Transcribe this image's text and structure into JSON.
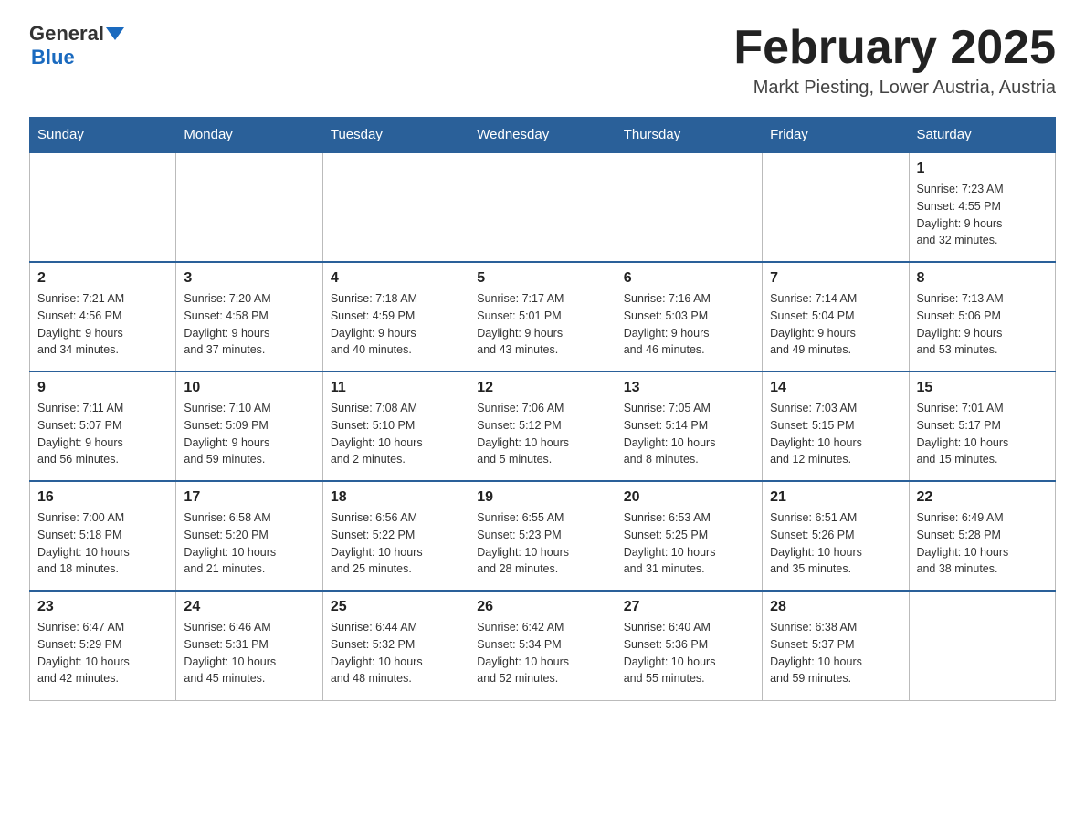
{
  "header": {
    "logo_line1": "General",
    "logo_line2": "Blue",
    "month_title": "February 2025",
    "location": "Markt Piesting, Lower Austria, Austria"
  },
  "calendar": {
    "days_of_week": [
      "Sunday",
      "Monday",
      "Tuesday",
      "Wednesday",
      "Thursday",
      "Friday",
      "Saturday"
    ],
    "weeks": [
      [
        {
          "day": "",
          "info": ""
        },
        {
          "day": "",
          "info": ""
        },
        {
          "day": "",
          "info": ""
        },
        {
          "day": "",
          "info": ""
        },
        {
          "day": "",
          "info": ""
        },
        {
          "day": "",
          "info": ""
        },
        {
          "day": "1",
          "info": "Sunrise: 7:23 AM\nSunset: 4:55 PM\nDaylight: 9 hours\nand 32 minutes."
        }
      ],
      [
        {
          "day": "2",
          "info": "Sunrise: 7:21 AM\nSunset: 4:56 PM\nDaylight: 9 hours\nand 34 minutes."
        },
        {
          "day": "3",
          "info": "Sunrise: 7:20 AM\nSunset: 4:58 PM\nDaylight: 9 hours\nand 37 minutes."
        },
        {
          "day": "4",
          "info": "Sunrise: 7:18 AM\nSunset: 4:59 PM\nDaylight: 9 hours\nand 40 minutes."
        },
        {
          "day": "5",
          "info": "Sunrise: 7:17 AM\nSunset: 5:01 PM\nDaylight: 9 hours\nand 43 minutes."
        },
        {
          "day": "6",
          "info": "Sunrise: 7:16 AM\nSunset: 5:03 PM\nDaylight: 9 hours\nand 46 minutes."
        },
        {
          "day": "7",
          "info": "Sunrise: 7:14 AM\nSunset: 5:04 PM\nDaylight: 9 hours\nand 49 minutes."
        },
        {
          "day": "8",
          "info": "Sunrise: 7:13 AM\nSunset: 5:06 PM\nDaylight: 9 hours\nand 53 minutes."
        }
      ],
      [
        {
          "day": "9",
          "info": "Sunrise: 7:11 AM\nSunset: 5:07 PM\nDaylight: 9 hours\nand 56 minutes."
        },
        {
          "day": "10",
          "info": "Sunrise: 7:10 AM\nSunset: 5:09 PM\nDaylight: 9 hours\nand 59 minutes."
        },
        {
          "day": "11",
          "info": "Sunrise: 7:08 AM\nSunset: 5:10 PM\nDaylight: 10 hours\nand 2 minutes."
        },
        {
          "day": "12",
          "info": "Sunrise: 7:06 AM\nSunset: 5:12 PM\nDaylight: 10 hours\nand 5 minutes."
        },
        {
          "day": "13",
          "info": "Sunrise: 7:05 AM\nSunset: 5:14 PM\nDaylight: 10 hours\nand 8 minutes."
        },
        {
          "day": "14",
          "info": "Sunrise: 7:03 AM\nSunset: 5:15 PM\nDaylight: 10 hours\nand 12 minutes."
        },
        {
          "day": "15",
          "info": "Sunrise: 7:01 AM\nSunset: 5:17 PM\nDaylight: 10 hours\nand 15 minutes."
        }
      ],
      [
        {
          "day": "16",
          "info": "Sunrise: 7:00 AM\nSunset: 5:18 PM\nDaylight: 10 hours\nand 18 minutes."
        },
        {
          "day": "17",
          "info": "Sunrise: 6:58 AM\nSunset: 5:20 PM\nDaylight: 10 hours\nand 21 minutes."
        },
        {
          "day": "18",
          "info": "Sunrise: 6:56 AM\nSunset: 5:22 PM\nDaylight: 10 hours\nand 25 minutes."
        },
        {
          "day": "19",
          "info": "Sunrise: 6:55 AM\nSunset: 5:23 PM\nDaylight: 10 hours\nand 28 minutes."
        },
        {
          "day": "20",
          "info": "Sunrise: 6:53 AM\nSunset: 5:25 PM\nDaylight: 10 hours\nand 31 minutes."
        },
        {
          "day": "21",
          "info": "Sunrise: 6:51 AM\nSunset: 5:26 PM\nDaylight: 10 hours\nand 35 minutes."
        },
        {
          "day": "22",
          "info": "Sunrise: 6:49 AM\nSunset: 5:28 PM\nDaylight: 10 hours\nand 38 minutes."
        }
      ],
      [
        {
          "day": "23",
          "info": "Sunrise: 6:47 AM\nSunset: 5:29 PM\nDaylight: 10 hours\nand 42 minutes."
        },
        {
          "day": "24",
          "info": "Sunrise: 6:46 AM\nSunset: 5:31 PM\nDaylight: 10 hours\nand 45 minutes."
        },
        {
          "day": "25",
          "info": "Sunrise: 6:44 AM\nSunset: 5:32 PM\nDaylight: 10 hours\nand 48 minutes."
        },
        {
          "day": "26",
          "info": "Sunrise: 6:42 AM\nSunset: 5:34 PM\nDaylight: 10 hours\nand 52 minutes."
        },
        {
          "day": "27",
          "info": "Sunrise: 6:40 AM\nSunset: 5:36 PM\nDaylight: 10 hours\nand 55 minutes."
        },
        {
          "day": "28",
          "info": "Sunrise: 6:38 AM\nSunset: 5:37 PM\nDaylight: 10 hours\nand 59 minutes."
        },
        {
          "day": "",
          "info": ""
        }
      ]
    ]
  }
}
